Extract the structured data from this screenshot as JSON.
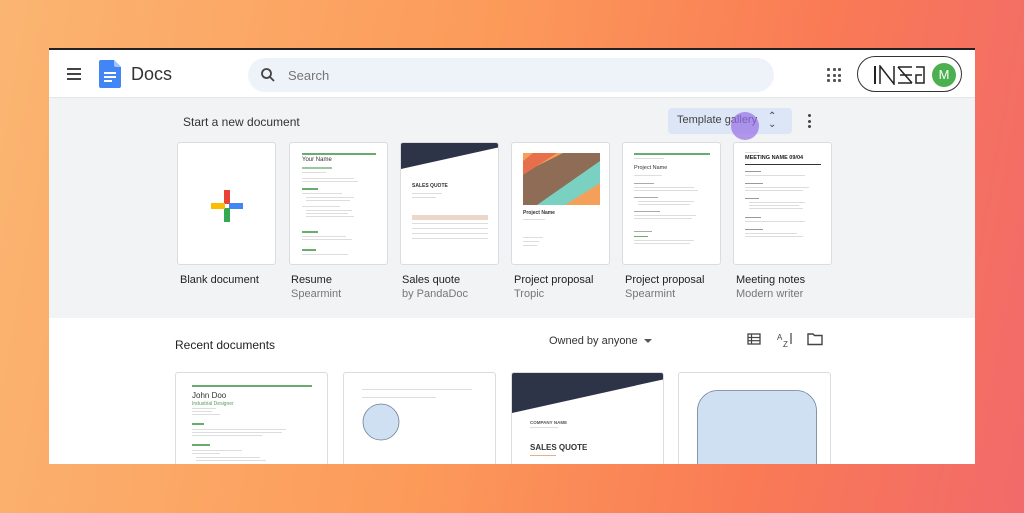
{
  "app": {
    "name": "Docs"
  },
  "search": {
    "placeholder": "Search"
  },
  "account": {
    "initial": "M"
  },
  "start": {
    "title": "Start a new document",
    "template_gallery_label": "Template gallery",
    "templates": [
      {
        "name": "Blank document",
        "sub": ""
      },
      {
        "name": "Resume",
        "sub": "Spearmint"
      },
      {
        "name": "Sales quote",
        "sub": "by PandaDoc"
      },
      {
        "name": "Project proposal",
        "sub": "Tropic"
      },
      {
        "name": "Project proposal",
        "sub": "Spearmint"
      },
      {
        "name": "Meeting notes",
        "sub": "Modern writer"
      }
    ],
    "thumbs": {
      "resume_name": "Your Name",
      "sales_title": "SALES QUOTE",
      "tropic_title": "Project Name",
      "spearmint_title": "Project Name",
      "meeting_title": "MEETING NAME 09/04"
    }
  },
  "recent": {
    "title": "Recent documents",
    "owner_filter": "Owned by anyone",
    "docs": [
      {
        "heading": "John Doo",
        "subheading": "Industrial Designer"
      },
      {
        "heading": "",
        "subheading": ""
      },
      {
        "heading": "SALES QUOTE",
        "subheading": "COMPANY NAME"
      },
      {
        "heading": "",
        "subheading": ""
      }
    ]
  },
  "icons": {
    "menu": "hamburger-icon",
    "logo": "docs-logo-icon",
    "search": "search-icon",
    "apps": "apps-grid-icon",
    "more": "more-vert-icon",
    "list_view": "list-view-icon",
    "sort": "sort-az-icon",
    "folder": "folder-icon"
  },
  "colors": {
    "accent": "#4285f4",
    "avatar": "#4caf50",
    "start_bg": "#f1f3f4"
  }
}
